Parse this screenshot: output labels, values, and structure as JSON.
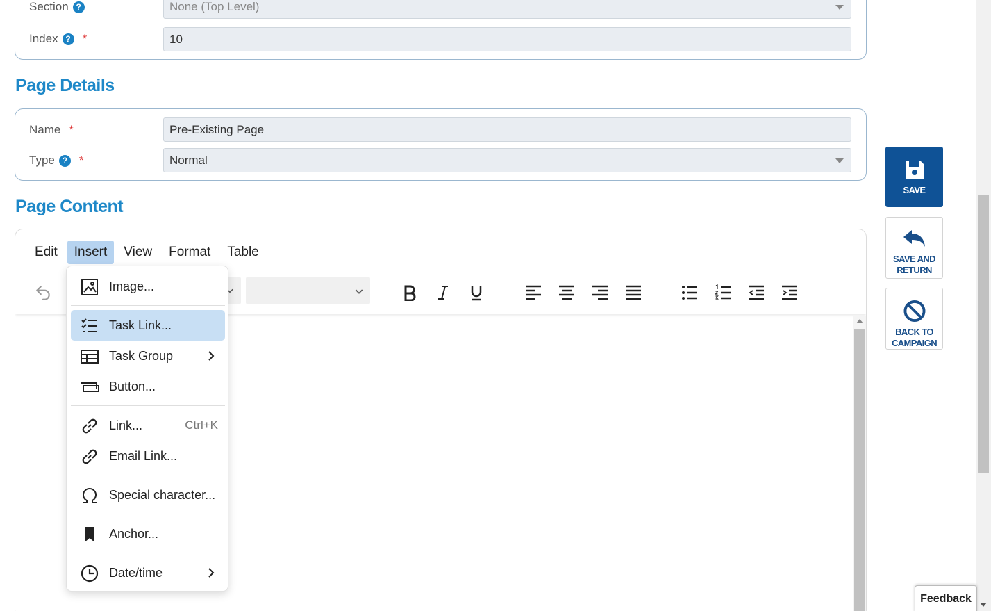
{
  "top_section": {
    "section_label": "Section",
    "section_value": "None (Top Level)",
    "index_label": "Index",
    "index_value": "10",
    "required_mark": "*",
    "help_mark": "?"
  },
  "page_details": {
    "title": "Page Details",
    "name_label": "Name",
    "name_value": "Pre-Existing Page",
    "type_label": "Type",
    "type_value": "Normal"
  },
  "page_content": {
    "title": "Page Content",
    "menubar": [
      "Edit",
      "Insert",
      "View",
      "Format",
      "Table"
    ],
    "active_menu": "Insert",
    "toolbar_icons": [
      "undo-icon",
      "bold-icon",
      "italic-icon",
      "underline-icon",
      "align-left-icon",
      "align-center-icon",
      "align-right-icon",
      "align-justify-icon",
      "bullet-list-icon",
      "numbered-list-icon",
      "outdent-icon",
      "indent-icon"
    ]
  },
  "insert_menu": {
    "items": [
      {
        "label": "Image...",
        "icon": "image-icon"
      },
      {
        "label": "Task Link...",
        "icon": "task-list-icon",
        "highlighted": true
      },
      {
        "label": "Task Group",
        "icon": "table-icon",
        "submenu": true
      },
      {
        "label": "Button...",
        "icon": "button-icon"
      },
      {
        "label": "Link...",
        "icon": "link-icon",
        "shortcut": "Ctrl+K"
      },
      {
        "label": "Email Link...",
        "icon": "link-icon"
      },
      {
        "label": "Special character...",
        "icon": "omega-icon"
      },
      {
        "label": "Anchor...",
        "icon": "bookmark-icon"
      },
      {
        "label": "Date/time",
        "icon": "clock-icon",
        "submenu": true
      }
    ]
  },
  "actions": {
    "save": "SAVE",
    "save_and_return_line1": "SAVE AND",
    "save_and_return_line2": "RETURN",
    "back_line1": "BACK TO",
    "back_line2": "CAMPAIGN"
  },
  "feedback_label": "Feedback",
  "colors": {
    "accent": "#1e88c8",
    "primary_button": "#0f5296",
    "menu_highlight": "#c8dff4",
    "help_badge": "#1a82c4",
    "required": "#dd3333"
  }
}
